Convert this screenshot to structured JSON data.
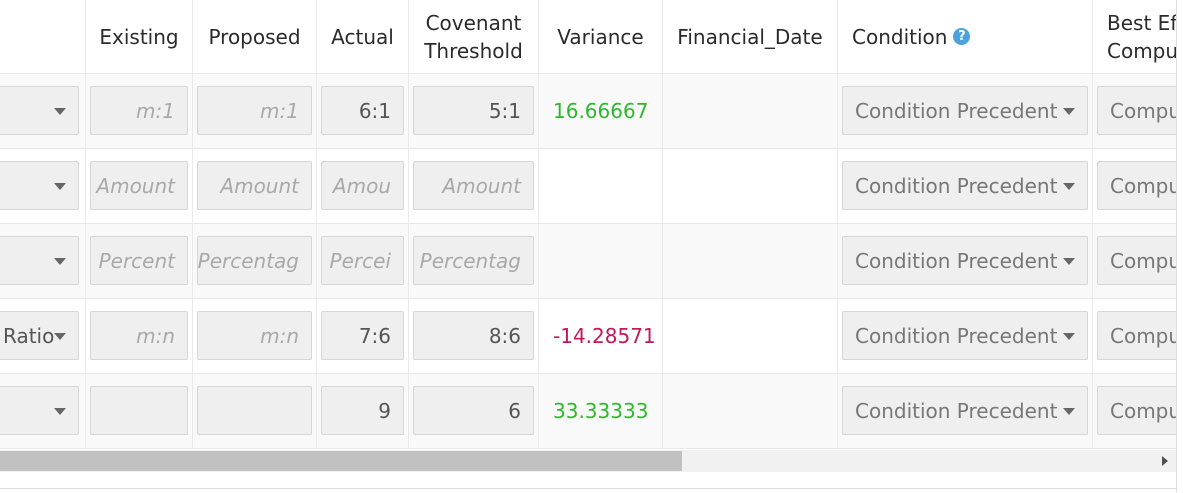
{
  "headers": {
    "col0": "",
    "existing": "Existing",
    "proposed": "Proposed",
    "actual": "Actual",
    "covenant_line1": "Covenant",
    "covenant_line2": "Threshold",
    "variance": "Variance",
    "financial_date": "Financial_Date",
    "condition": "Condition",
    "best_line1": "Best Ef",
    "best_line2": "Compu"
  },
  "help_icon_glyph": "?",
  "rows": [
    {
      "type_value": "",
      "existing": "m:1",
      "existing_placeholder": true,
      "proposed": "m:1",
      "proposed_placeholder": true,
      "actual": "6:1",
      "actual_placeholder": false,
      "threshold": "5:1",
      "threshold_placeholder": false,
      "variance": "16.66667",
      "variance_sign": "pos",
      "financial_date": "",
      "condition": "Condition Precedent",
      "best": "Compu"
    },
    {
      "type_value": "",
      "existing": "Amount",
      "existing_placeholder": true,
      "proposed": "Amount",
      "proposed_placeholder": true,
      "actual": "Amou",
      "actual_placeholder": true,
      "threshold": "Amount",
      "threshold_placeholder": true,
      "variance": "",
      "variance_sign": "",
      "financial_date": "",
      "condition": "Condition Precedent",
      "best": "Compu"
    },
    {
      "type_value": "",
      "existing": "Percent",
      "existing_placeholder": true,
      "proposed": "Percentag",
      "proposed_placeholder": true,
      "actual": "Percei",
      "actual_placeholder": true,
      "threshold": "Percentag",
      "threshold_placeholder": true,
      "variance": "",
      "variance_sign": "",
      "financial_date": "",
      "condition": "Condition Precedent",
      "best": "Compu"
    },
    {
      "type_value": "Ratio",
      "existing": "m:n",
      "existing_placeholder": true,
      "proposed": "m:n",
      "proposed_placeholder": true,
      "actual": "7:6",
      "actual_placeholder": false,
      "threshold": "8:6",
      "threshold_placeholder": false,
      "variance": "-14.28571",
      "variance_sign": "neg",
      "financial_date": "",
      "condition": "Condition Precedent",
      "best": "Compu"
    },
    {
      "type_value": "",
      "existing": "",
      "existing_placeholder": false,
      "proposed": "",
      "proposed_placeholder": false,
      "actual": "9",
      "actual_placeholder": false,
      "threshold": "6",
      "threshold_placeholder": false,
      "variance": "33.33333",
      "variance_sign": "pos",
      "financial_date": "",
      "condition": "Condition Precedent",
      "best": "Compu"
    }
  ],
  "colors": {
    "positive": "#2eb82e",
    "negative": "#c2185b",
    "help_icon": "#4aa3df"
  },
  "scroll": {
    "horizontal_position": 0.58
  }
}
